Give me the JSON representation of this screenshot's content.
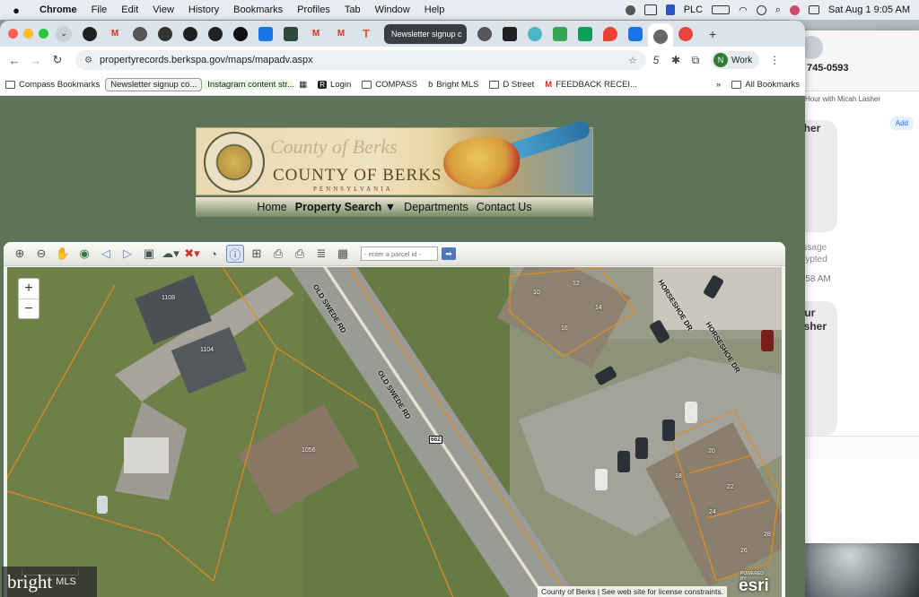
{
  "menubar": {
    "app": "Chrome",
    "menus": [
      "File",
      "Edit",
      "View",
      "History",
      "Bookmarks",
      "Profiles",
      "Tab",
      "Window",
      "Help"
    ],
    "status_label": "PLC",
    "datetime": "Sat Aug 1  9:05 AM"
  },
  "tabs": {
    "active_title": "Newsletter signup c"
  },
  "address": {
    "url": "propertyrecords.berkspa.gov/maps/mapadv.aspx",
    "profile_letter": "N",
    "profile_label": "Work",
    "ext_count": "5"
  },
  "bookmarks": {
    "items": [
      "Compass Bookmarks",
      "Newsletter signup co...",
      "Instagram content str...",
      "Login",
      "COMPASS",
      "Bright MLS",
      "D Street",
      "FEEDBACK RECEI..."
    ],
    "all_label": "All Bookmarks"
  },
  "site": {
    "banner_title": "COUNTY OF BERKS",
    "banner_state": "PENNSYLVANIA",
    "banner_script": "County of Berks",
    "nav": [
      "Home",
      "Property Search ▼",
      "Departments",
      "Contact Us"
    ]
  },
  "map": {
    "parcel_placeholder": "- enter a parcel id -",
    "zoom_in": "+",
    "zoom_out": "−",
    "street_1": "OLD SWEDE RD",
    "street_2": "OLD SWEDE RD",
    "street_3": "HORSESHOE DR",
    "street_4": "HORSESHOE DR",
    "route_shield": "662",
    "parcels": [
      "1108",
      "1104",
      "1056",
      "10",
      "12",
      "14",
      "16",
      "18",
      "20",
      "22",
      "24",
      "26",
      "28"
    ],
    "attribution": "County of Berks | See web site for license constraints.",
    "esri_label": "esri",
    "esri_powered": "POWERED BY"
  },
  "messages": {
    "phone": "745-0593",
    "meeting": "Hour with Micah Lasher",
    "add": "Add",
    "bubble_1": "sher",
    "meta": "essage\ncrypted",
    "time": "8:58 AM",
    "bubble_2": "our\nasher"
  },
  "watermark": {
    "brand": "bright",
    "suffix": "MLS"
  }
}
